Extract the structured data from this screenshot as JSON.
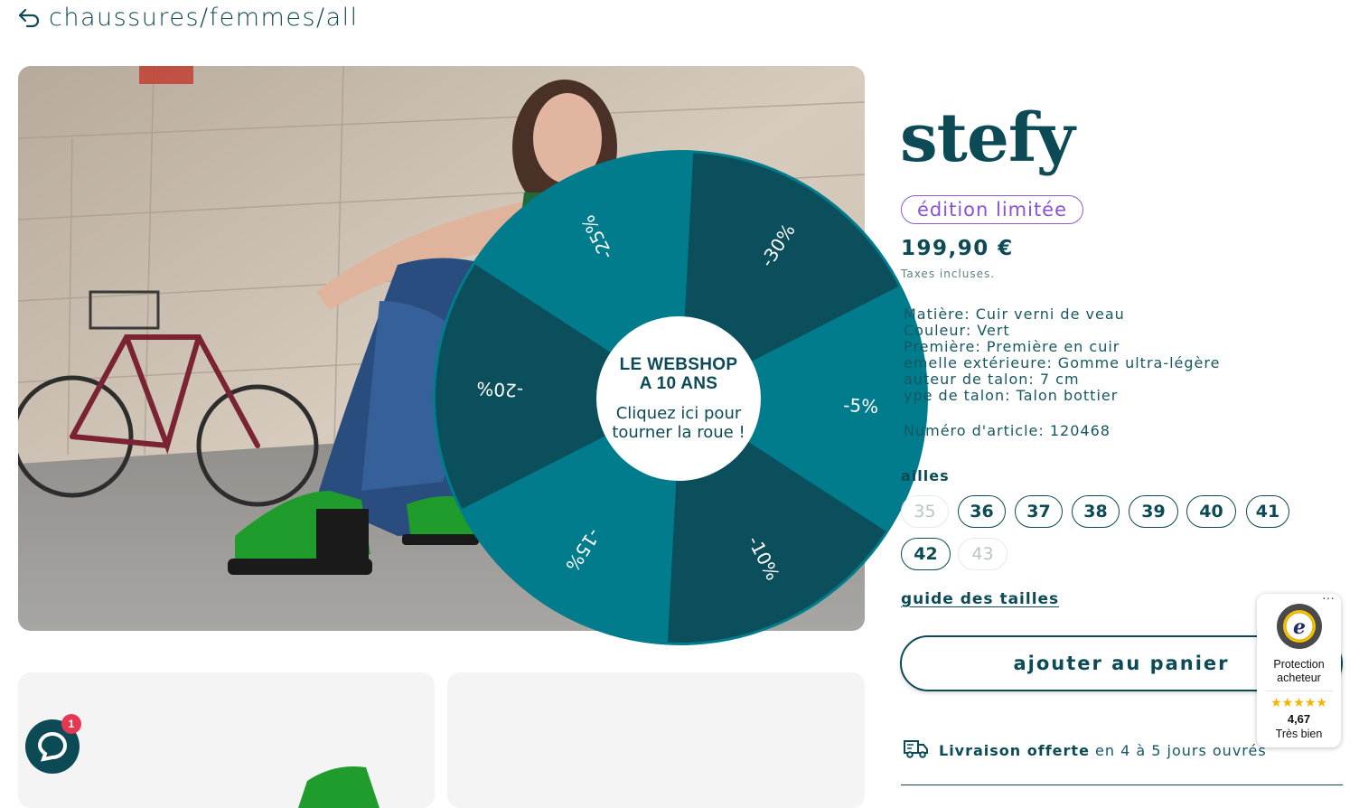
{
  "breadcrumb": {
    "icon": "back-arrow-icon",
    "path": "chaussures/femmes/all"
  },
  "wheel": {
    "title_line1": "LE WEBSHOP",
    "title_line2": "A 10 ANS",
    "cta": "Cliquez ici pour tourner la roue !",
    "segments": [
      {
        "label": "-30%",
        "color": "#0b4f5c"
      },
      {
        "label": "-5%",
        "color": "#017c8c"
      },
      {
        "label": "-10%",
        "color": "#0b4f5c"
      },
      {
        "label": "-15%",
        "color": "#017c8c"
      },
      {
        "label": "-20%",
        "color": "#0b4f5c"
      },
      {
        "label": "-25%",
        "color": "#017c8c"
      }
    ]
  },
  "product": {
    "name": "stefy",
    "badge": "édition limitée",
    "price": "199,90 €",
    "tax_note": "Taxes incluses.",
    "specs": [
      "Matière: Cuir verni de veau",
      "Couleur: Vert",
      "Première: Première en cuir",
      "emelle extérieure: Gomme ultra-légère",
      "auteur de talon: 7 cm",
      "ype de talon: Talon bottier"
    ],
    "article": "Numéro d'article: 120468",
    "sizes_label": "ailles",
    "sizes": [
      "35",
      "36",
      "37",
      "38",
      "39",
      "40",
      "41",
      "42",
      "43"
    ],
    "size_guide": "guide des tailles",
    "add_to_cart": "ajouter au panier",
    "delivery_bold": "Livraison offerte",
    "delivery_text": "en 4 à 5 jours ouvrés"
  },
  "trusted_shops": {
    "more": "···",
    "label_line1": "Protection",
    "label_line2": "acheteur",
    "stars": "★★★★★",
    "score": "4,67",
    "verdict": "Très bien"
  },
  "chat": {
    "badge_count": "1"
  },
  "colors": {
    "brand": "#0c4a55",
    "teal": "#017c8c",
    "dark_teal": "#0b4f5c",
    "badge_purple": "#8a53d4"
  }
}
